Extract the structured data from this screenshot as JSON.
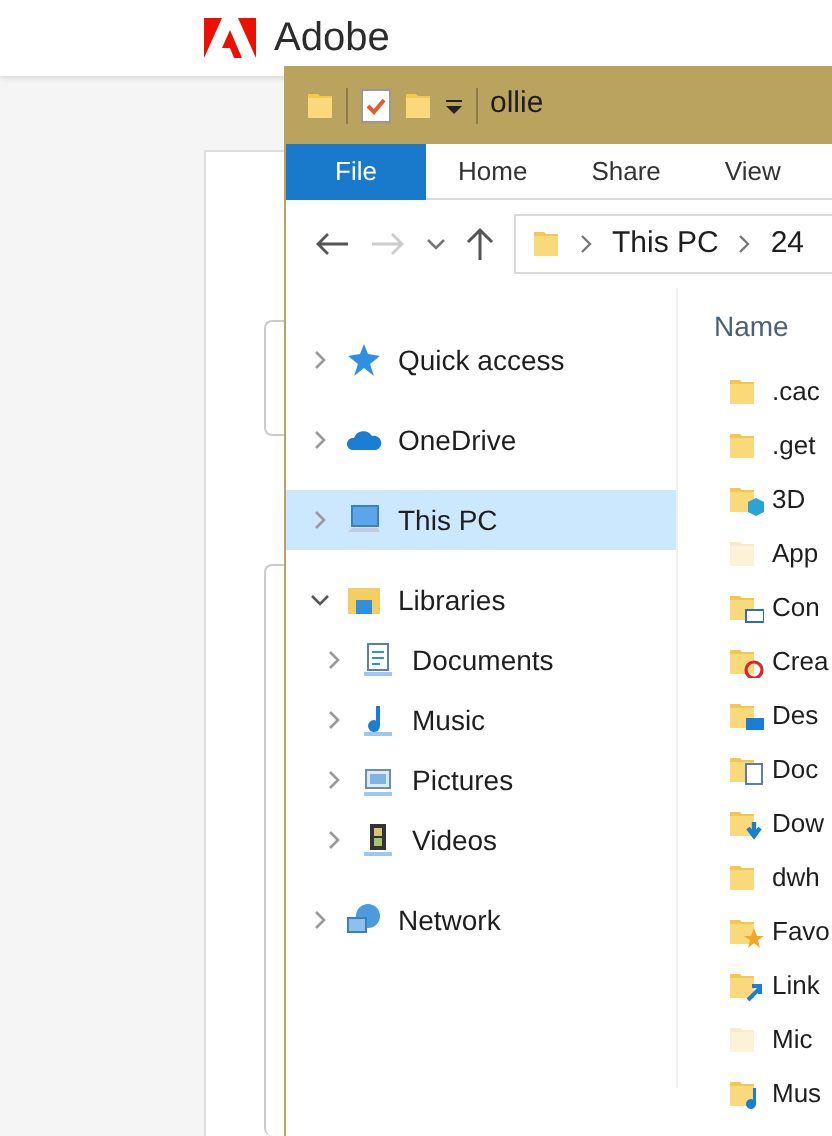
{
  "header": {
    "brand": "Adobe"
  },
  "explorer": {
    "title": "ollie",
    "ribbon_tabs": [
      {
        "label": "File",
        "kind": "file"
      },
      {
        "label": "Home",
        "kind": "tab"
      },
      {
        "label": "Share",
        "kind": "tab"
      },
      {
        "label": "View",
        "kind": "tab"
      }
    ],
    "address": {
      "path": [
        "This PC",
        "24"
      ]
    },
    "nav": [
      {
        "label": "Quick access",
        "kind": "star",
        "selected": false,
        "expanded": false
      },
      {
        "label": "OneDrive",
        "kind": "cloud",
        "selected": false,
        "expanded": false
      },
      {
        "label": "This PC",
        "kind": "computer",
        "selected": true,
        "expanded": false
      },
      {
        "label": "Libraries",
        "kind": "library",
        "selected": false,
        "expanded": true,
        "children": [
          {
            "label": "Documents",
            "kind": "document",
            "selected": false,
            "expanded": false
          },
          {
            "label": "Music",
            "kind": "music",
            "selected": false,
            "expanded": false
          },
          {
            "label": "Pictures",
            "kind": "pictures",
            "selected": false,
            "expanded": false
          },
          {
            "label": "Videos",
            "kind": "film",
            "selected": false,
            "expanded": false
          }
        ]
      },
      {
        "label": "Network",
        "kind": "network",
        "selected": false,
        "expanded": false
      }
    ],
    "list": {
      "column": "Name",
      "items": [
        {
          "name": ".cac",
          "kind": "plain"
        },
        {
          "name": ".get",
          "kind": "plain"
        },
        {
          "name": "3D",
          "kind": "cube"
        },
        {
          "name": "App",
          "kind": "faded"
        },
        {
          "name": "Con",
          "kind": "contacts"
        },
        {
          "name": "Crea",
          "kind": "creative"
        },
        {
          "name": "Des",
          "kind": "desktop"
        },
        {
          "name": "Doc",
          "kind": "documents"
        },
        {
          "name": "Dow",
          "kind": "downloads"
        },
        {
          "name": "dwh",
          "kind": "plain"
        },
        {
          "name": "Favo",
          "kind": "favorites"
        },
        {
          "name": "Link",
          "kind": "links"
        },
        {
          "name": "Mic",
          "kind": "faded"
        },
        {
          "name": "Mus",
          "kind": "music"
        }
      ]
    }
  }
}
